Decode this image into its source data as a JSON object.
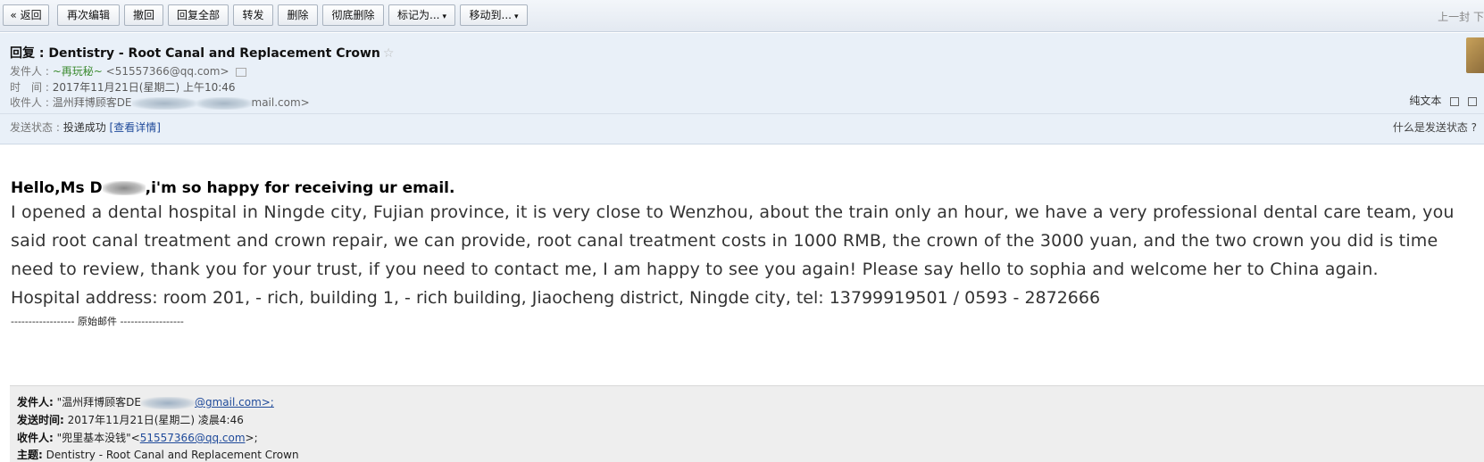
{
  "toolbar": {
    "buttons": [
      {
        "label": "« 返回"
      },
      {
        "label": "再次编辑"
      },
      {
        "label": "撤回"
      },
      {
        "label": "回复全部"
      },
      {
        "label": "转发"
      },
      {
        "label": "删除"
      },
      {
        "label": "彻底删除"
      },
      {
        "label": "标记为..."
      },
      {
        "label": "移动到..."
      }
    ],
    "prev_next": "上一封 下"
  },
  "header": {
    "subject": "回复 : Dentistry - Root Canal and Replacement Crown",
    "from_label": "发件人 :",
    "from_name": "~再玩秘~",
    "from_addr": "<51557366@qq.com>",
    "time_label": "时　间 :",
    "time_value": "2017年11月21日(星期二) 上午10:46",
    "to_label": "收件人 :",
    "to_name": "温州拜博顾客DE",
    "to_addr_tail": "mail.com>",
    "plain_text": "纯文本",
    "status_label": "发送状态 :",
    "status_value": "投递成功",
    "status_link": "[查看详情]",
    "help_link": "什么是发送状态 ?"
  },
  "body": {
    "greeting_start": "Hello,Ms D",
    "greeting_end": ",i'm so happy for receiving ur email.",
    "paragraph": "I opened a dental hospital in Ningde city, Fujian province, it is very close to Wenzhou, about the train only an hour, we have a very professional dental care team, you said root canal treatment and crown repair, we can provide, root canal treatment costs in 1000 RMB, the crown of the 3000 yuan, and the  two crown you did is time need to review, thank you for your trust, if you need to contact me, I am happy to see you again! Please say hello to sophia and welcome her to China again.",
    "address": "Hospital address: room 201, - rich, building 1, - rich building, Jiaocheng district, Ningde city, tel: 13799919501 / 0593 - 2872666",
    "original_separator": "------------------ 原始邮件 ------------------"
  },
  "quote": {
    "from_label": "发件人:",
    "from_name": "\"温州拜博顾客DE",
    "from_addr_tail": "@gmail.com>;",
    "sent_label": "发送时间:",
    "sent_value": "2017年11月21日(星期二) 凌晨4:46",
    "to_label": "收件人:",
    "to_name": "\"兜里基本没钱\"<",
    "to_addr": "51557366@qq.com",
    "to_tail": ">;",
    "subject_label": "主题:",
    "subject_value": "Dentistry - Root Canal and Replacement Crown"
  },
  "colors": {
    "header_bg": "#e9f0f8",
    "link": "#1f4a9a",
    "quote_bg": "#eeeeee"
  }
}
